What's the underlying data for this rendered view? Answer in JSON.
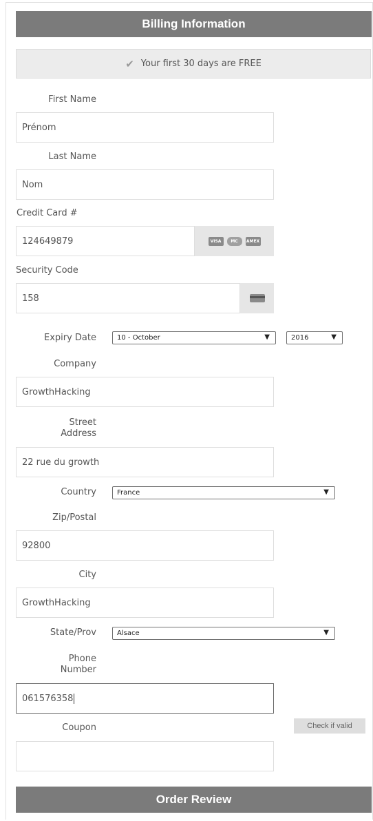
{
  "header": {
    "title": "Billing Information"
  },
  "free_banner": {
    "text": "Your first 30 days are FREE",
    "icon": "checkmark-icon"
  },
  "form": {
    "first_name": {
      "label": "First Name",
      "value": "Prénom"
    },
    "last_name": {
      "label": "Last Name",
      "value": "Nom"
    },
    "credit_card": {
      "label": "Credit Card #",
      "value": "124649879",
      "card_logos": [
        "VISA",
        "MC",
        "AMEX"
      ]
    },
    "security_code": {
      "label": "Security Code",
      "value": "158"
    },
    "expiry": {
      "label": "Expiry Date",
      "month": "10 - October",
      "year": "2016"
    },
    "company": {
      "label": "Company",
      "value": "GrowthHacking"
    },
    "street": {
      "label_line1": "Street",
      "label_line2": "Address",
      "value": "22 rue du growth"
    },
    "country": {
      "label": "Country",
      "value": "France"
    },
    "zip": {
      "label": "Zip/Postal",
      "value": "92800"
    },
    "city": {
      "label": "City",
      "value": "GrowthHacking"
    },
    "state": {
      "label": "State/Prov",
      "value": "Alsace"
    },
    "phone": {
      "label_line1": "Phone",
      "label_line2": "Number",
      "value": "061576358"
    },
    "coupon": {
      "label": "Coupon",
      "value": "",
      "check_button": "Check if valid"
    }
  },
  "footer": {
    "title": "Order Review"
  },
  "colors": {
    "header_bg": "#7b7b7b",
    "banner_bg": "#ececec",
    "addon_bg": "#e6e6e6"
  }
}
